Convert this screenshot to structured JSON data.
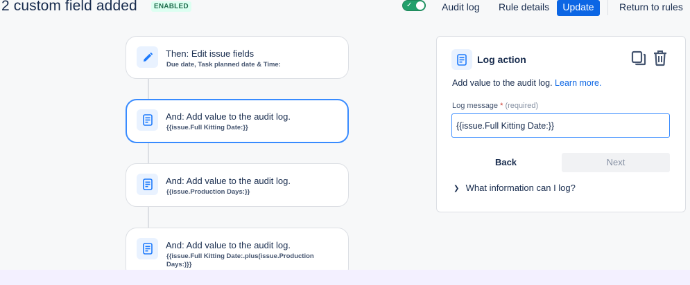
{
  "header": {
    "title": "2 custom field added",
    "status_badge": "ENABLED",
    "toggle_on": true,
    "audit_log_label": "Audit log",
    "rule_details_label": "Rule details",
    "update_label": "Update",
    "return_label": "Return to rules",
    "accent_color": "#0c66e4"
  },
  "flow": {
    "nodes": [
      {
        "title": "Then: Edit issue fields",
        "subtitle": "Due date, Task planned date & Time:",
        "icon": "pencil-icon",
        "selected": false
      },
      {
        "title": "And: Add value to the audit log.",
        "subtitle": "{{issue.Full Kitting Date:}}",
        "icon": "document-icon",
        "selected": true
      },
      {
        "title": "And: Add value to the audit log.",
        "subtitle": "{{issue.Production Days:}}",
        "icon": "document-icon",
        "selected": false
      },
      {
        "title": "And: Add value to the audit log.",
        "subtitle": "{{issue.Full Kitting Date:.plus(issue.Production Days:)}}",
        "icon": "document-icon",
        "selected": false
      }
    ]
  },
  "panel": {
    "title": "Log action",
    "icon": "document-icon",
    "description": "Add value to the audit log.",
    "learn_more": "Learn more.",
    "field_label": "Log message",
    "required_star": "*",
    "required_hint": "(required)",
    "log_message_value": "{{issue.Full Kitting Date:}}",
    "back_label": "Back",
    "next_label": "Next",
    "expander_label": "What information can I log?"
  }
}
